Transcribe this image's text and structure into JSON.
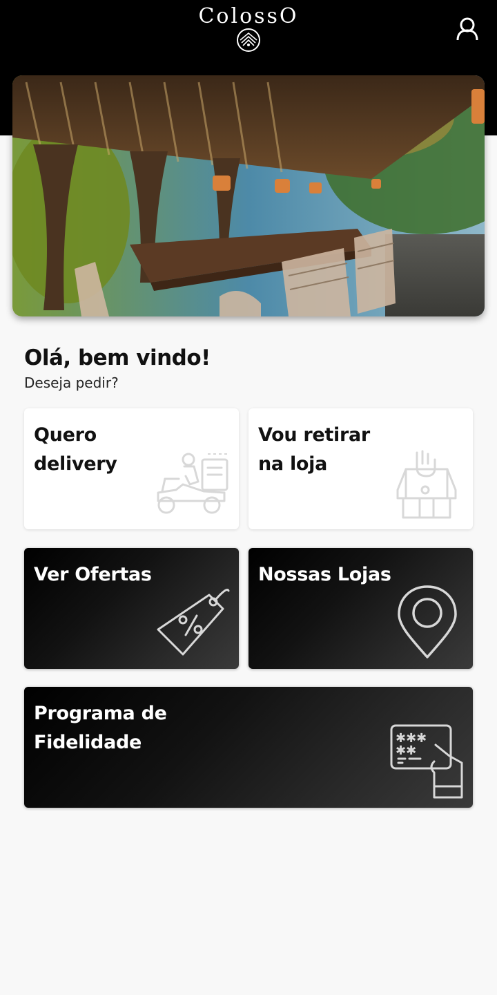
{
  "header": {
    "brand_name": "ColossO",
    "logo_icon": "colosso-emblem-icon",
    "user_icon": "user-profile-icon"
  },
  "hero": {
    "image_description": "restaurant-patio-photo"
  },
  "greeting": {
    "title": "Olá, bem vindo!",
    "subtitle": "Deseja pedir?"
  },
  "cards": {
    "delivery": {
      "label": "Quero delivery",
      "icon": "delivery-scooter-icon"
    },
    "pickup": {
      "label": "Vou retirar na loja",
      "icon": "store-pickup-icon"
    },
    "offers": {
      "label": "Ver Ofertas",
      "icon": "discount-tag-icon"
    },
    "stores": {
      "label": "Nossas Lojas",
      "icon": "location-pin-icon"
    },
    "loyalty": {
      "label": "Programa de Fidelidade",
      "icon": "loyalty-card-icon"
    }
  },
  "colors": {
    "header_bg": "#000000",
    "page_bg": "#f8f8f8",
    "card_light": "#ffffff",
    "card_dark": "#111111"
  }
}
